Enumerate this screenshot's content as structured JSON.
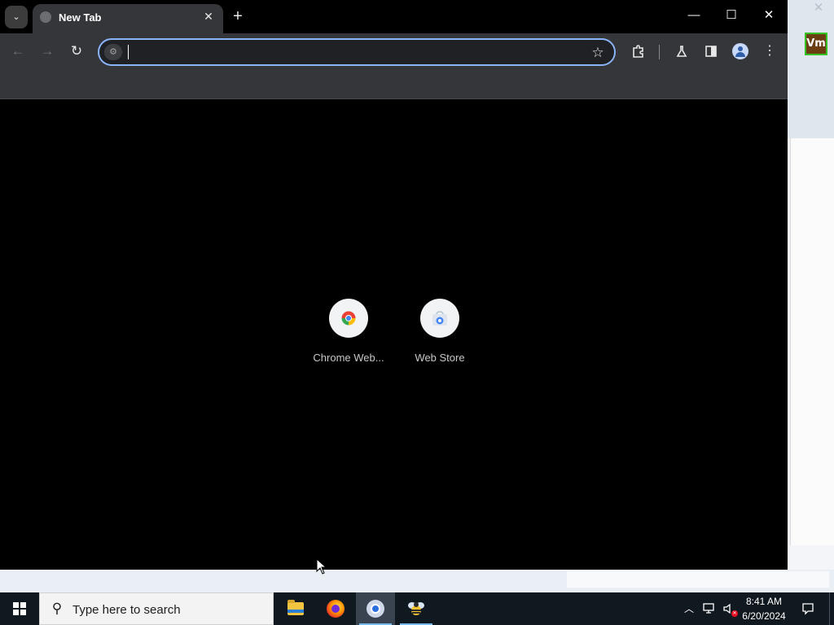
{
  "browser": {
    "tab": {
      "title": "New Tab"
    },
    "omnibox": {
      "value": "",
      "placeholder": ""
    },
    "shortcuts": [
      {
        "label": "Chrome Web..."
      },
      {
        "label": "Web Store"
      }
    ]
  },
  "background_window": {
    "badge": "Vm"
  },
  "taskbar": {
    "search_placeholder": "Type here to search",
    "time": "8:41 AM",
    "date": "6/20/2024"
  },
  "colors": {
    "accent": "#8ab4f8",
    "toolbar": "#35363a",
    "taskbar": "#101820"
  },
  "icons": [
    "tab-search-icon",
    "globe-icon",
    "close-icon",
    "plus-icon",
    "minimize-icon",
    "maximize-icon",
    "back-arrow-icon",
    "forward-arrow-icon",
    "reload-icon",
    "star-icon",
    "puzzle-icon",
    "flask-icon",
    "side-panel-icon",
    "profile-icon",
    "more-vert-icon",
    "windows-icon",
    "search-icon",
    "file-explorer-icon",
    "firefox-icon",
    "chrome-icon",
    "bee-app-icon",
    "chevron-up-icon",
    "network-icon",
    "speaker-muted-icon",
    "notification-icon"
  ]
}
